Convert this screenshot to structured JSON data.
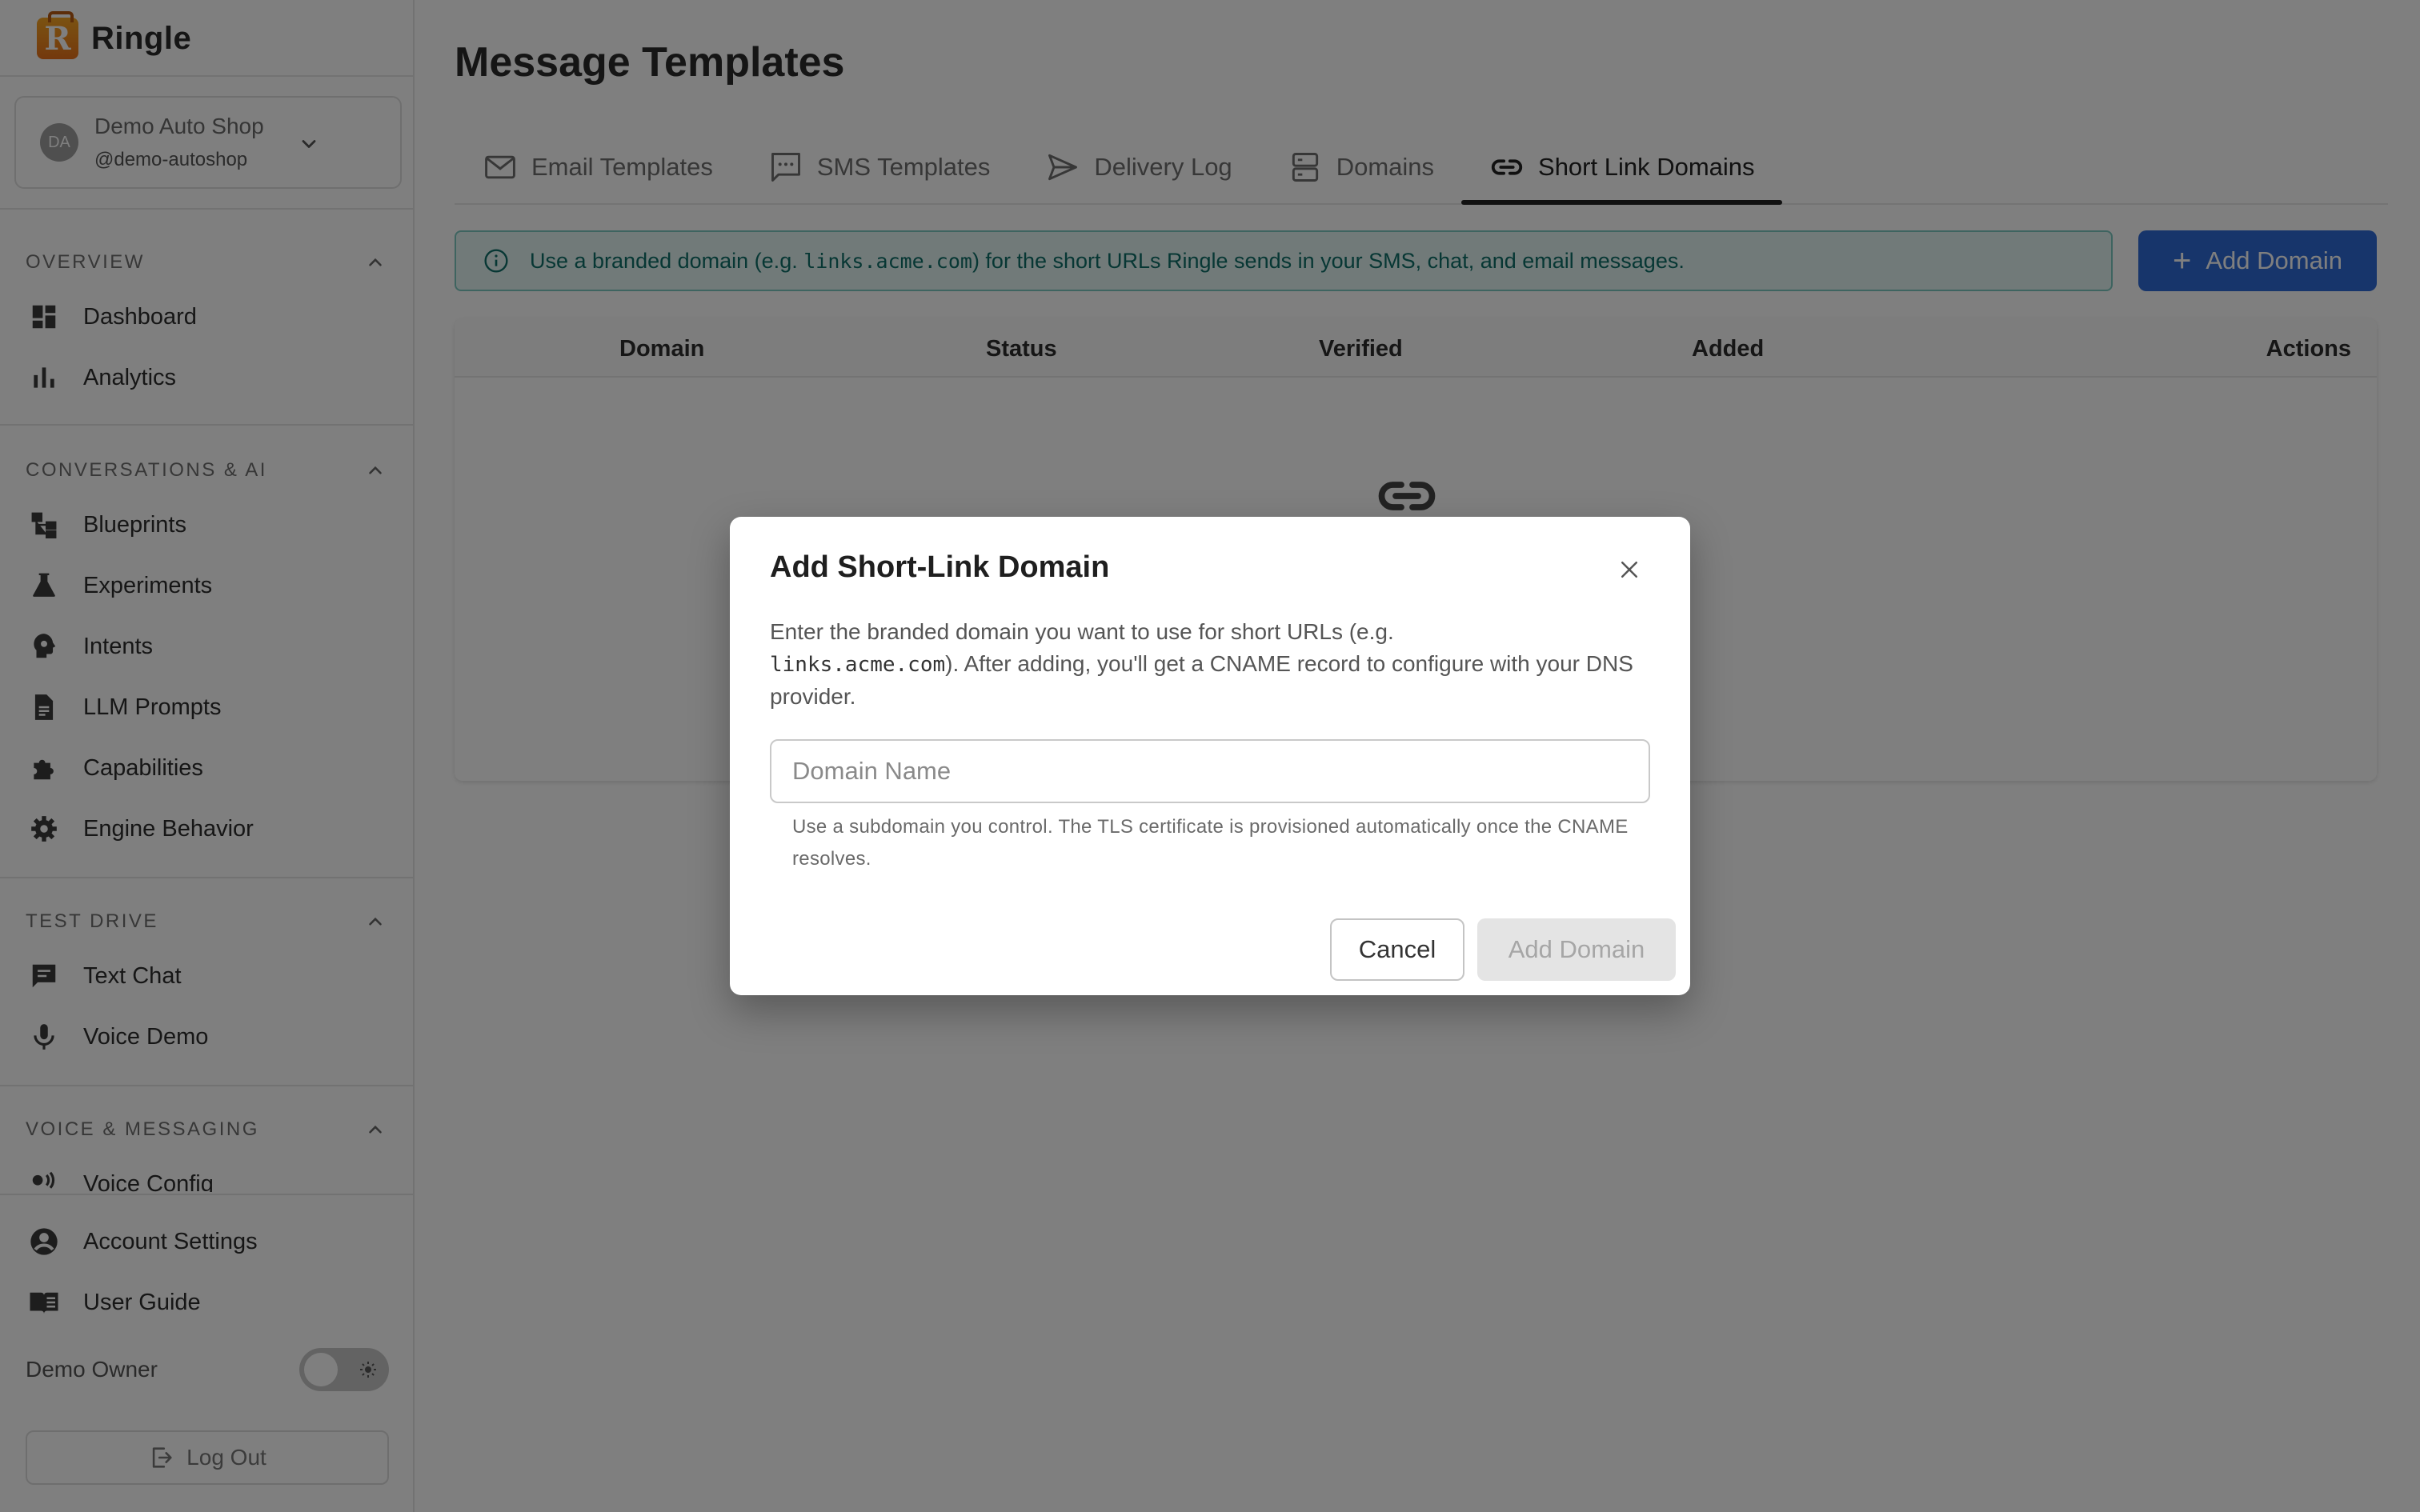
{
  "brand": {
    "name": "Ringle",
    "logo_letter": "R"
  },
  "org": {
    "initials": "DA",
    "name": "Demo Auto Shop",
    "handle": "@demo-autoshop"
  },
  "sidebar": {
    "sections": [
      {
        "title": "OVERVIEW",
        "items": [
          {
            "label": "Dashboard",
            "icon": "dashboard-icon"
          },
          {
            "label": "Analytics",
            "icon": "bar-chart-icon"
          }
        ]
      },
      {
        "title": "CONVERSATIONS & AI",
        "items": [
          {
            "label": "Blueprints",
            "icon": "flow-icon"
          },
          {
            "label": "Experiments",
            "icon": "flask-icon"
          },
          {
            "label": "Intents",
            "icon": "head-icon"
          },
          {
            "label": "LLM Prompts",
            "icon": "document-icon"
          },
          {
            "label": "Capabilities",
            "icon": "puzzle-icon"
          },
          {
            "label": "Engine Behavior",
            "icon": "gear-icon"
          }
        ]
      },
      {
        "title": "TEST DRIVE",
        "items": [
          {
            "label": "Text Chat",
            "icon": "chat-icon"
          },
          {
            "label": "Voice Demo",
            "icon": "microphone-icon"
          }
        ]
      },
      {
        "title": "VOICE & MESSAGING",
        "items": [
          {
            "label": "Voice Config",
            "icon": "voice-icon"
          }
        ]
      }
    ],
    "bottom": [
      {
        "label": "Account Settings",
        "icon": "account-icon"
      },
      {
        "label": "User Guide",
        "icon": "book-icon"
      }
    ],
    "owner": "Demo Owner",
    "logout": "Log Out"
  },
  "page": {
    "title": "Message Templates"
  },
  "tabs": [
    {
      "label": "Email Templates",
      "icon": "mail-icon"
    },
    {
      "label": "SMS Templates",
      "icon": "sms-icon"
    },
    {
      "label": "Delivery Log",
      "icon": "send-icon"
    },
    {
      "label": "Domains",
      "icon": "server-icon"
    },
    {
      "label": "Short Link Domains",
      "icon": "link-icon",
      "active": true
    }
  ],
  "banner": {
    "before": "Use a branded domain (e.g. ",
    "code": "links.acme.com",
    "after": ") for the short URLs Ringle sends in your SMS, chat, and email messages."
  },
  "actions": {
    "add_domain": "Add Domain",
    "plus": "+"
  },
  "table": {
    "columns": [
      "Domain",
      "Status",
      "Verified",
      "Added",
      "Actions"
    ]
  },
  "modal": {
    "title": "Add Short-Link Domain",
    "desc_before": "Enter the branded domain you want to use for short URLs (e.g.",
    "desc_code": "links.acme.com",
    "desc_after": "). After adding, you'll get a CNAME record to configure with your DNS provider.",
    "input_placeholder": "Domain Name",
    "input_value": "",
    "helper": "Use a subdomain you control. The TLS certificate is provisioned automatically once the CNAME resolves.",
    "cancel": "Cancel",
    "submit": "Add Domain"
  },
  "colors": {
    "accent": "#2e6bd6",
    "info_bg": "#e3f5f3",
    "info_text": "#0f6f68",
    "brand_orange": "#e8711a"
  }
}
